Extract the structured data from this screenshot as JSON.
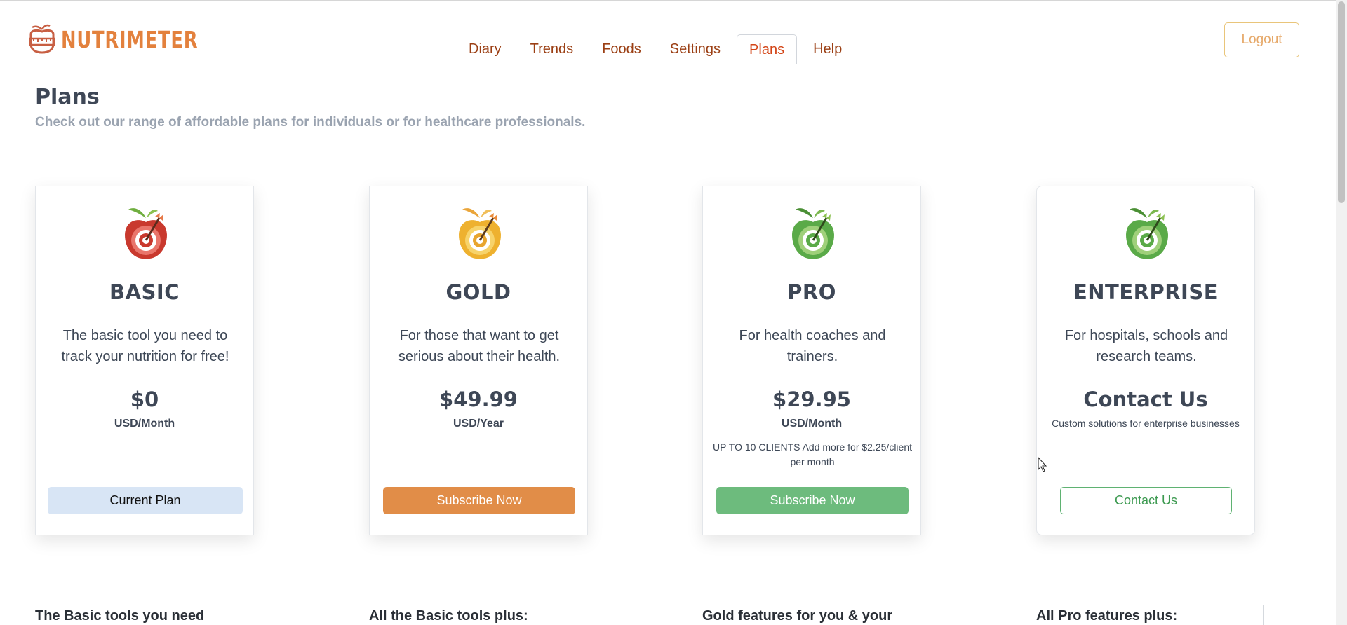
{
  "brand": {
    "name": "NUTRIMETER",
    "logo_icon": "apple-scale-icon"
  },
  "nav": {
    "tabs": [
      {
        "label": "Diary",
        "active": false
      },
      {
        "label": "Trends",
        "active": false
      },
      {
        "label": "Foods",
        "active": false
      },
      {
        "label": "Settings",
        "active": false
      },
      {
        "label": "Plans",
        "active": true
      },
      {
        "label": "Help",
        "active": false
      }
    ],
    "logout_label": "Logout"
  },
  "page": {
    "title": "Plans",
    "subtitle": "Check out our range of affordable plans for individuals or for healthcare professionals."
  },
  "plans": [
    {
      "name": "BASIC",
      "icon": "red-apple-target-icon",
      "color": "#c9392e",
      "description": "The basic tool you need to track your nutrition for free!",
      "price": "$0",
      "period": "USD/Month",
      "button_label": "Current Plan"
    },
    {
      "name": "GOLD",
      "icon": "gold-apple-target-icon",
      "color": "#e8a52e",
      "description": "For those that want to get serious about their health.",
      "price": "$49.99",
      "period": "USD/Year",
      "button_label": "Subscribe Now"
    },
    {
      "name": "PRO",
      "icon": "green-apple-target-icon",
      "color": "#5aaa48",
      "description": "For health coaches and trainers.",
      "price": "$29.95",
      "period": "USD/Month",
      "note": "UP TO 10 CLIENTS Add more for $2.25/client per month",
      "button_label": "Subscribe Now"
    },
    {
      "name": "ENTERPRISE",
      "icon": "green-apple-target-icon",
      "color": "#5aaa48",
      "description": "For hospitals, schools and research teams.",
      "price": "Contact Us",
      "note": "Custom solutions for enterprise businesses",
      "button_label": "Contact Us"
    }
  ],
  "features": [
    "The Basic tools you need",
    "All the Basic tools plus:",
    "Gold features for you & your",
    "All Pro features plus:"
  ]
}
